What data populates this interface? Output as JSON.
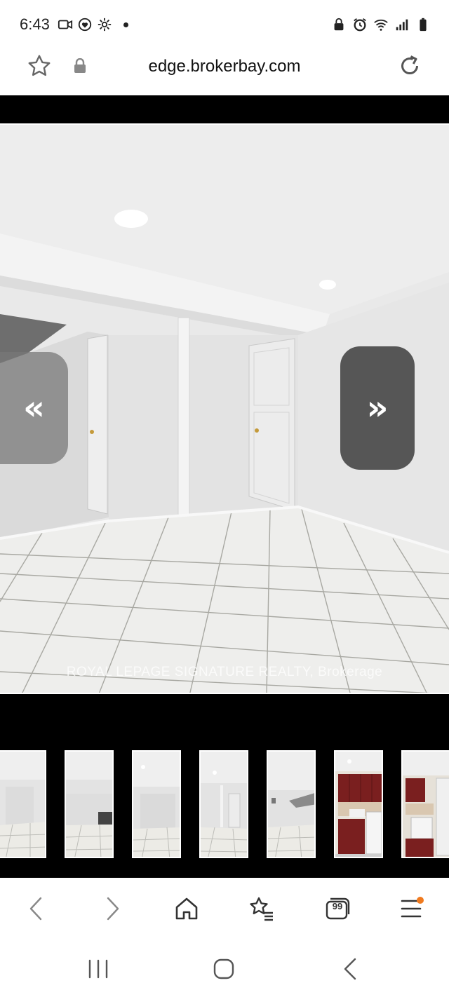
{
  "status_bar": {
    "time": "6:43",
    "left_icons": [
      "video-call-icon",
      "heart-app-icon",
      "settings-gear-icon",
      "notification-dot"
    ],
    "right_icons": [
      "lock-icon",
      "alarm-icon",
      "wifi-icon",
      "signal-icon",
      "battery-icon"
    ]
  },
  "address_bar": {
    "url": "edge.brokerbay.com",
    "favorite_icon": "star-outline-icon",
    "secure_icon": "lock-icon",
    "reload_icon": "reload-icon"
  },
  "viewer": {
    "watermark": "ROYAL LEPAGE SIGNATURE REALTY, Brokerage",
    "prev_label": "«",
    "next_label": "»",
    "thumbnails": [
      {
        "scene": "basement-room"
      },
      {
        "scene": "basement-room"
      },
      {
        "scene": "basement-room"
      },
      {
        "scene": "basement-room"
      },
      {
        "scene": "basement-stairs"
      },
      {
        "scene": "kitchen"
      },
      {
        "scene": "kitchen"
      }
    ]
  },
  "toolbar": {
    "back_icon": "chevron-left-icon",
    "forward_icon": "chevron-right-icon",
    "home_icon": "home-icon",
    "bookmarks_icon": "star-list-icon",
    "tabs_count": "99",
    "menu_icon": "hamburger-menu-icon",
    "menu_badge_color": "#f07a1e"
  },
  "android_nav": {
    "recents_icon": "recents-icon",
    "home_icon": "home-circle-icon",
    "back_icon": "back-icon"
  }
}
